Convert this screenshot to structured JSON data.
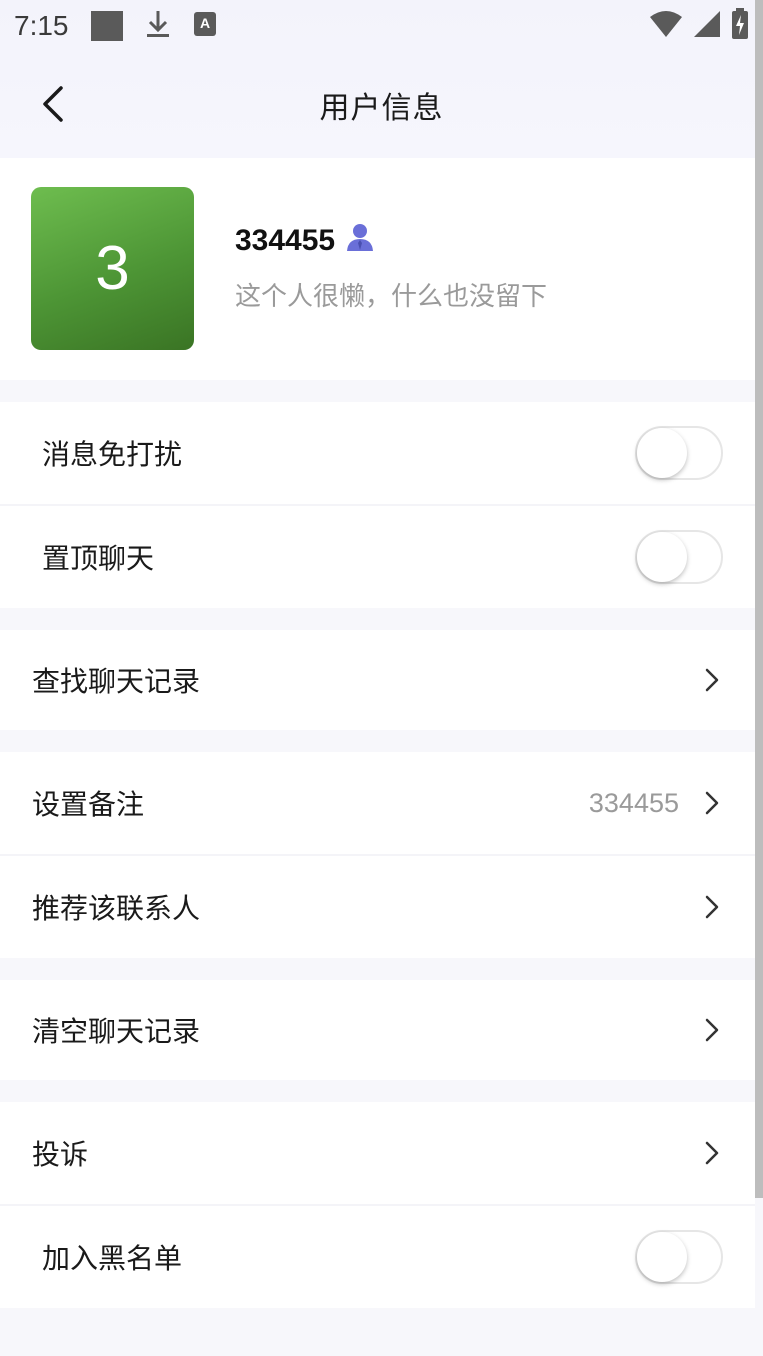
{
  "status_bar": {
    "time": "7:15"
  },
  "nav": {
    "title": "用户信息"
  },
  "profile": {
    "avatar_text": "3",
    "name": "334455",
    "signature": "这个人很懒，什么也没留下",
    "avatar_color": "#4d9535"
  },
  "settings": {
    "do_not_disturb": {
      "label": "消息免打扰",
      "enabled": false
    },
    "pin_chat": {
      "label": "置顶聊天",
      "enabled": false
    },
    "search_history": {
      "label": "查找聊天记录"
    },
    "remark": {
      "label": "设置备注",
      "value": "334455"
    },
    "recommend": {
      "label": "推荐该联系人"
    },
    "clear_history": {
      "label": "清空聊天记录"
    },
    "report": {
      "label": "投诉"
    },
    "blacklist": {
      "label": "加入黑名单",
      "enabled": false
    }
  },
  "colors": {
    "accent_icon": "#6a6fd8",
    "secondary_text": "#9a9a9a"
  }
}
